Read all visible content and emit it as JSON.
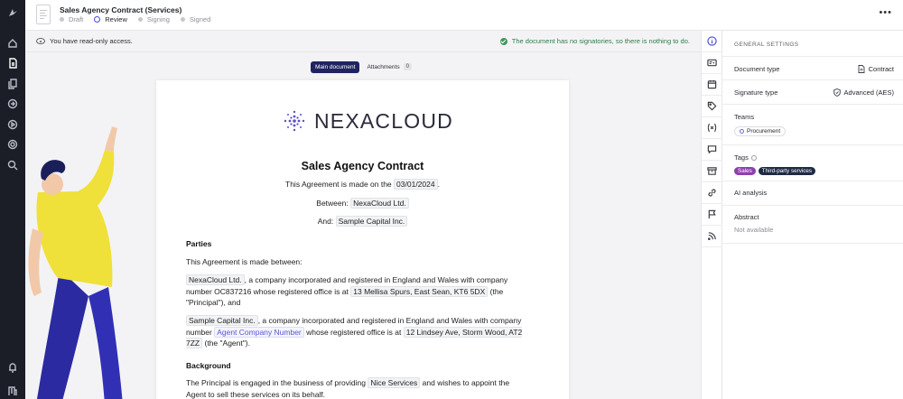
{
  "header": {
    "title": "Sales Agency Contract (Services)",
    "steps": [
      {
        "label": "Draft",
        "state": "done"
      },
      {
        "label": "Review",
        "state": "current"
      },
      {
        "label": "Signing",
        "state": "pending"
      },
      {
        "label": "Signed",
        "state": "pending"
      }
    ],
    "more_icon": "more-icon"
  },
  "notice": {
    "readonly": "You have read-only access.",
    "signatories": "The document has no signatories, so there is nothing to do."
  },
  "doc_tabs": {
    "main": "Main document",
    "attachments": "Attachments",
    "attachments_count": "0"
  },
  "document": {
    "logo_text": "NEXACLOUD",
    "heading": "Sales Agency Contract",
    "made_on_prefix": "This Agreement is made on the",
    "made_on_date": "03/01/2024",
    "made_on_suffix": ".",
    "between_label": "Between:",
    "between_value": "NexaCloud Ltd.",
    "and_label": "And:",
    "and_value": "Sample Capital Inc.",
    "parties_heading": "Parties",
    "parties_intro": "This Agreement is made between:",
    "p1_party": "NexaCloud Ltd.",
    "p1_text_a": ", a company incorporated and registered in England and Wales with company number OC837216 whose registered office is at",
    "p1_address": "13 Mellisa Spurs, East Sean, KT6 5DX",
    "p1_text_b": "(the \"Principal\"), and",
    "p2_party": "Sample Capital Inc.",
    "p2_text_a": ", a company incorporated and registered in England and Wales with company number",
    "p2_number": "Agent Company Number",
    "p2_text_b": "whose registered office is at",
    "p2_address": "12 Lindsey Ave, Storm Wood, AT2 7ZZ",
    "p2_text_c": "(the \"Agent\").",
    "background_heading": "Background",
    "bg_text_a": "The Principal is engaged in the business of providing",
    "bg_services": "Nice Services",
    "bg_text_b": "and wishes to appoint the Agent to sell these services on its behalf."
  },
  "panel": {
    "title": "GENERAL SETTINGS",
    "doc_type_label": "Document type",
    "doc_type_value": "Contract",
    "sig_type_label": "Signature type",
    "sig_type_value": "Advanced (AES)",
    "teams_label": "Teams",
    "team": "Procurement",
    "tags_label": "Tags",
    "tags": [
      {
        "label": "Sales",
        "color": "#8e3fb0"
      },
      {
        "label": "Third-party services",
        "color": "#1f2a44"
      }
    ],
    "ai_label": "AI analysis",
    "abstract_label": "Abstract",
    "abstract_value": "Not available"
  },
  "colors": {
    "accent": "#4c4ad6",
    "rail": "#1b1d27",
    "primary_tab": "#1f2460",
    "success": "#2f7d4a"
  }
}
